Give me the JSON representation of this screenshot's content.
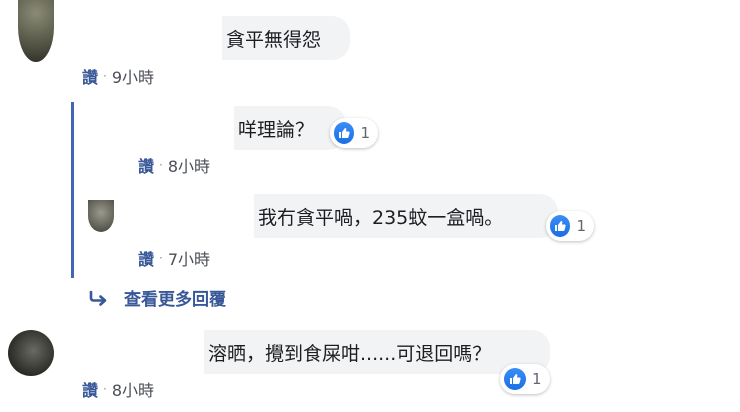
{
  "colors": {
    "accent": "#385898",
    "thread_line": "#4267b2",
    "bubble_bg": "#f2f3f5",
    "reaction_blue": "#1a6fe6"
  },
  "comments": [
    {
      "text": "貪平無得怨",
      "like": "讚",
      "sep": "·",
      "time": "9小時"
    },
    {
      "text": "咩理論？",
      "like": "讚",
      "sep": "·",
      "time": "8小時",
      "reaction_icon": "thumbs-up-icon",
      "reaction_count": "1"
    },
    {
      "text": "我冇貪平喎，235蚊一盒喎。",
      "like": "讚",
      "sep": "·",
      "time": "7小時",
      "reaction_icon": "thumbs-up-icon",
      "reaction_count": "1"
    },
    {
      "text": "溶晒，攪到食屎咁......可退回嗎？",
      "like": "讚",
      "sep": "·",
      "time": "8小時",
      "reaction_icon": "thumbs-up-icon",
      "reaction_count": "1"
    }
  ],
  "more_replies": {
    "icon": "reply-arrow-icon",
    "label": "查看更多回覆"
  }
}
